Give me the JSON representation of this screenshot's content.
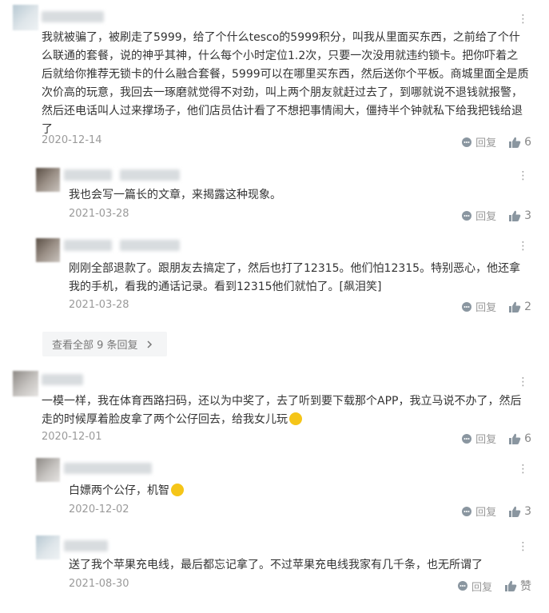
{
  "comments": [
    {
      "text": "我就被骗了，被刷走了5999，给了个什么tesco的5999积分，叫我从里面买东西，之前给了个什么联通的套餐，说的神乎其神，什么每个小时定位1.2次，只要一次没用就违约锁卡。把你吓着之后就给你推荐无锁卡的什么融合套餐，5999可以在哪里买东西，然后送你个平板。商城里面全是质次价高的玩意，我回去一琢磨就觉得不对劲，叫上两个朋友就赶过去了，到哪就说不退钱就报警，然后还电话叫人过来撑场子，他们店员估计看了不想把事情闹大，僵持半个钟就私下给我把钱给退了",
      "date": "2020-12-14",
      "reply_label": "回复",
      "likes": "6"
    },
    {
      "text": "我也会写一篇长的文章，来揭露这种现象。",
      "date": "2021-03-28",
      "reply_label": "回复",
      "likes": "3"
    },
    {
      "text": "刚刚全部退款了。跟朋友去搞定了，然后也打了12315。他们怕12315。特别恶心，他还拿我的手机，看我的通话记录。看到12315他们就怕了。",
      "emoji_alt": "[飙泪笑]",
      "date": "2021-03-28",
      "reply_label": "回复",
      "likes": "2"
    },
    {
      "text": "一模一样，我在体育西路扫码，还以为中奖了，去了听到要下载那个APP，我立马说不办了，然后走的时候厚着脸皮拿了两个公仔回去，给我女儿玩",
      "date": "2020-12-01",
      "reply_label": "回复",
      "likes": "6"
    },
    {
      "text": "白嫖两个公仔，机智",
      "date": "2020-12-02",
      "reply_label": "回复",
      "likes": "3"
    },
    {
      "text": "送了我个苹果充电线，最后都忘记拿了。不过苹果充电线我家有几千条，也无所谓了",
      "date": "2021-08-30",
      "reply_label": "回复",
      "likes": "赞"
    }
  ],
  "view_all": "查看全部 9 条回复",
  "colors": {
    "text": "#333333",
    "meta": "#999999",
    "emoji": "#f5c518"
  },
  "icons": [
    "more-icon",
    "reply-icon",
    "like-icon",
    "chevron-right-icon"
  ]
}
